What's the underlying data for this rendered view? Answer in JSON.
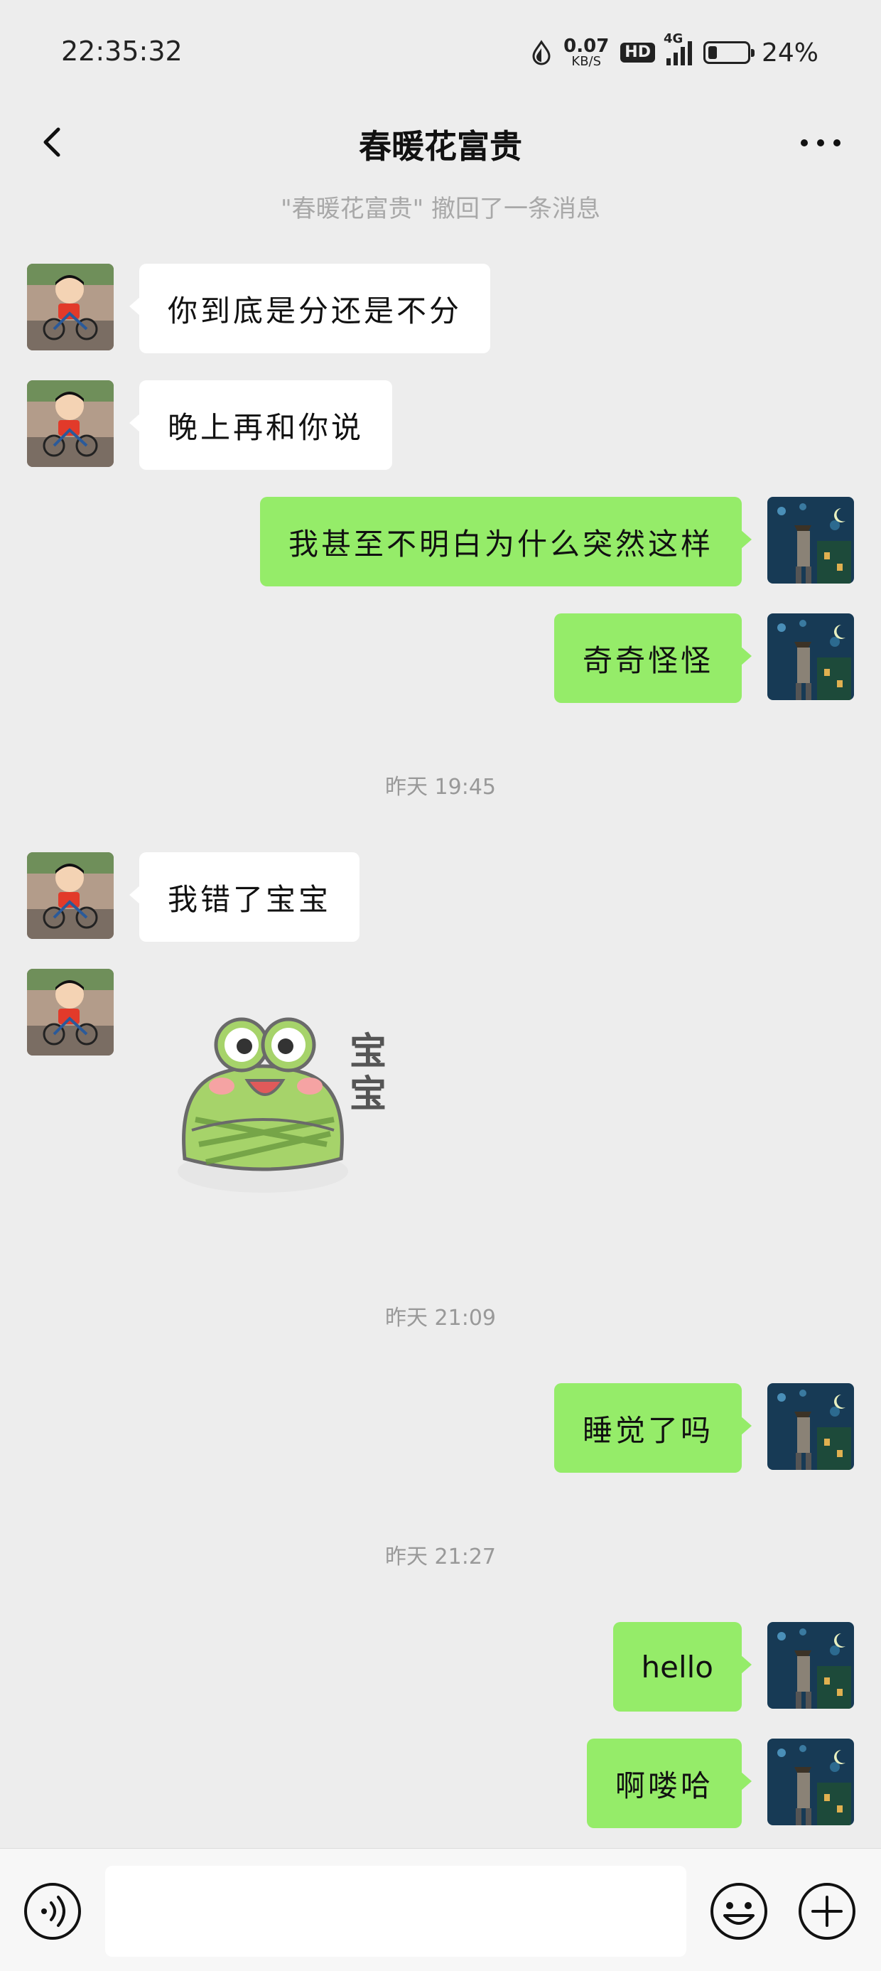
{
  "status_bar": {
    "time": "22:35:32",
    "net_speed_value": "0.07",
    "net_speed_unit": "KB/S",
    "hd_badge": "HD",
    "network": "4G",
    "battery_text": "24%",
    "battery_level": 0.24
  },
  "header": {
    "title": "春暖花富贵",
    "back_icon": "chevron-left-icon",
    "more_icon": "more-dots-icon"
  },
  "recall_notice": "\"春暖花富贵\" 撤回了一条消息",
  "messages": [
    {
      "side": "in",
      "text": "你到底是分还是不分"
    },
    {
      "side": "in",
      "text": "晚上再和你说"
    },
    {
      "side": "out",
      "text": "我甚至不明白为什么突然这样"
    },
    {
      "side": "out",
      "text": "奇奇怪怪"
    },
    {
      "type": "time",
      "text": "昨天 19:45"
    },
    {
      "side": "in",
      "text": "我错了宝宝"
    },
    {
      "side": "in",
      "type": "sticker",
      "sticker_text": "宝宝"
    },
    {
      "type": "time",
      "text": "昨天 21:09"
    },
    {
      "side": "out",
      "text": "睡觉了吗"
    },
    {
      "type": "time",
      "text": "昨天 21:27"
    },
    {
      "side": "out",
      "text": "hello"
    },
    {
      "side": "out",
      "text": "啊喽哈"
    }
  ],
  "input_bar": {
    "voice_icon": "voice-icon",
    "input_value": "",
    "emoji_icon": "emoji-icon",
    "plus_icon": "plus-icon"
  },
  "colors": {
    "background": "#ededed",
    "outgoing_bubble": "#95ec69",
    "incoming_bubble": "#ffffff",
    "input_bar": "#f7f7f7"
  }
}
